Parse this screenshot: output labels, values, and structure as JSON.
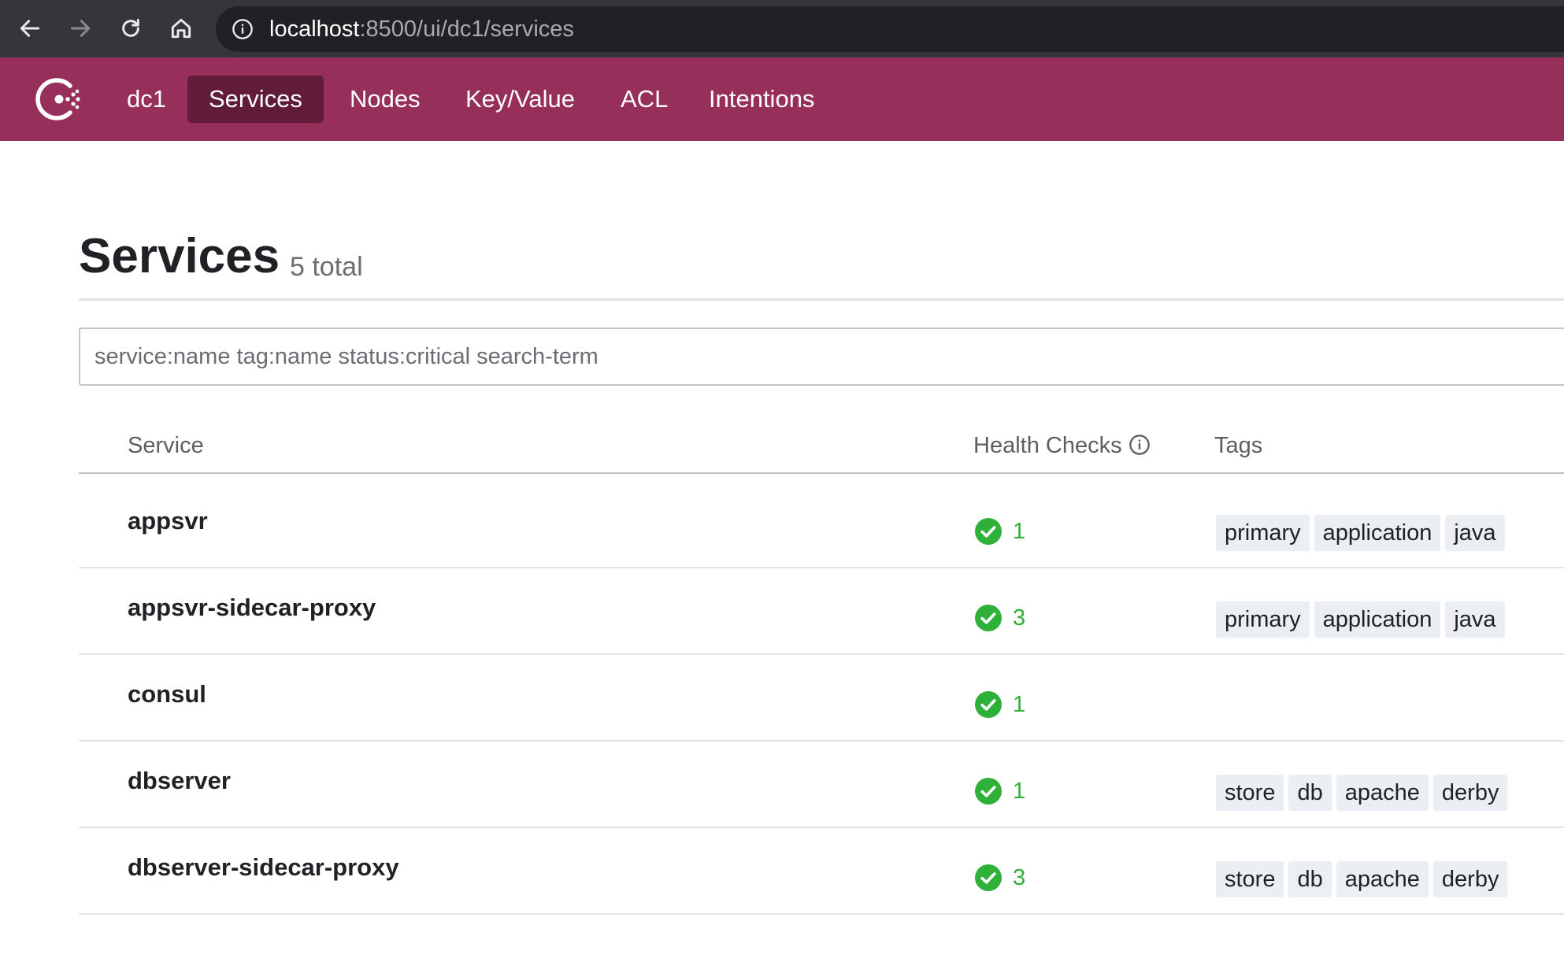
{
  "browser": {
    "url_host": "localhost",
    "url_path": ":8500/ui/dc1/services"
  },
  "nav": {
    "datacenter": "dc1",
    "items": [
      {
        "label": "Services",
        "active": true
      },
      {
        "label": "Nodes"
      },
      {
        "label": "Key/Value"
      },
      {
        "label": "ACL"
      },
      {
        "label": "Intentions"
      }
    ]
  },
  "page": {
    "title": "Services",
    "count": "5 total"
  },
  "search": {
    "placeholder": "service:name tag:name status:critical search-term",
    "value": ""
  },
  "table": {
    "headers": {
      "service": "Service",
      "health": "Health Checks",
      "tags": "Tags"
    },
    "rows": [
      {
        "name": "appsvr",
        "checks": "1",
        "tags": [
          "primary",
          "application",
          "java"
        ]
      },
      {
        "name": "appsvr-sidecar-proxy",
        "checks": "3",
        "tags": [
          "primary",
          "application",
          "java"
        ]
      },
      {
        "name": "consul",
        "checks": "1",
        "tags": []
      },
      {
        "name": "dbserver",
        "checks": "1",
        "tags": [
          "store",
          "db",
          "apache",
          "derby"
        ]
      },
      {
        "name": "dbserver-sidecar-proxy",
        "checks": "3",
        "tags": [
          "store",
          "db",
          "apache",
          "derby"
        ]
      }
    ]
  },
  "colors": {
    "brand": "#962f5a",
    "brand_active": "#611c3a",
    "passing": "#2eb039"
  },
  "icons": [
    "back-arrow-icon",
    "forward-arrow-icon",
    "reload-icon",
    "home-icon",
    "info-icon",
    "consul-logo-icon",
    "check-circle-icon"
  ]
}
